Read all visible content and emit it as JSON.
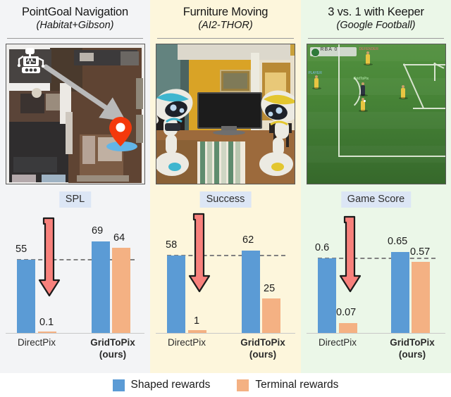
{
  "panels": [
    {
      "title": "PointGoal Navigation",
      "subtitle": "(Habitat+Gibson)",
      "bg": "#f3f4f6",
      "thumb_kind": "apartment-topdown",
      "metric_label": "SPL",
      "chart_data": {
        "type": "bar",
        "title": "SPL",
        "categories": [
          "DirectPix",
          "GridToPix\n(ours)"
        ],
        "series": [
          {
            "name": "Shaped rewards",
            "color": "#5b9bd5",
            "values": [
              55,
              69
            ],
            "labels": [
              "55",
              "69"
            ]
          },
          {
            "name": "Terminal rewards",
            "color": "#f4b183",
            "values": [
              0.1,
              64
            ],
            "labels": [
              "0.1",
              "64"
            ]
          }
        ],
        "reference_line": 55,
        "ylim": [
          0,
          88
        ],
        "annotation_arrow": {
          "from": 55,
          "to": 0.1,
          "color": "#f4746f"
        },
        "grid": false
      }
    },
    {
      "title": "Furniture Moving",
      "subtitle": "(AI2-THOR)",
      "bg": "#fdf6dc",
      "thumb_kind": "thor-livingroom",
      "metric_label": "Success",
      "chart_data": {
        "type": "bar",
        "title": "Success",
        "categories": [
          "DirectPix",
          "GridToPix\n(ours)"
        ],
        "series": [
          {
            "name": "Shaped rewards",
            "color": "#5b9bd5",
            "values": [
              58,
              62
            ],
            "labels": [
              "58",
              "62"
            ]
          },
          {
            "name": "Terminal rewards",
            "color": "#f4b183",
            "values": [
              1,
              25
            ],
            "labels": [
              "1",
              "25"
            ]
          }
        ],
        "reference_line": 58,
        "ylim": [
          0,
          88
        ],
        "annotation_arrow": {
          "from": 58,
          "to": 1,
          "color": "#f4746f"
        },
        "grid": false
      }
    },
    {
      "title": "3 vs. 1 with Keeper",
      "subtitle": "(Google Football)",
      "bg": "#ebf7e8",
      "thumb_kind": "google-football",
      "metric_label": "Game Score",
      "chart_data": {
        "type": "bar",
        "title": "Game Score",
        "categories": [
          "DirectPix",
          "GridToPix\n(ours)"
        ],
        "series": [
          {
            "name": "Shaped rewards",
            "color": "#5b9bd5",
            "values": [
              0.6,
              0.65
            ],
            "labels": [
              "0.6",
              "0.65"
            ]
          },
          {
            "name": "Terminal rewards",
            "color": "#f4b183",
            "values": [
              0.07,
              0.57
            ],
            "labels": [
              "0.07",
              "0.57"
            ]
          }
        ],
        "reference_line": 0.6,
        "ylim": [
          0,
          0.96
        ],
        "annotation_arrow": {
          "from": 0.6,
          "to": 0.07,
          "color": "#f4746f"
        },
        "grid": false
      }
    }
  ],
  "x_labels": {
    "direct": "DirectPix",
    "grid_l1": "GridToPix",
    "grid_l2": "(ours)"
  },
  "legend": {
    "items": [
      {
        "label": "Shaped rewards",
        "color": "#5b9bd5"
      },
      {
        "label": "Terminal rewards",
        "color": "#f4b183"
      }
    ]
  },
  "football_hud": {
    "score": "RBA  0"
  },
  "football_tags": {
    "red": "DEFENDER",
    "green": "GridToPix",
    "blue": "PLAYER"
  }
}
